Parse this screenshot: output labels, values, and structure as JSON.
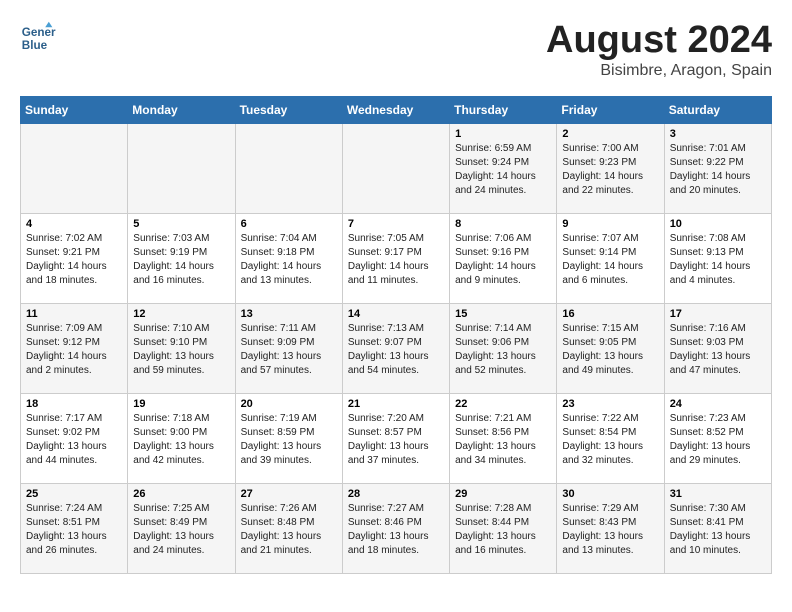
{
  "logo": {
    "line1": "General",
    "line2": "Blue"
  },
  "title": "August 2024",
  "location": "Bisimbre, Aragon, Spain",
  "weekdays": [
    "Sunday",
    "Monday",
    "Tuesday",
    "Wednesday",
    "Thursday",
    "Friday",
    "Saturday"
  ],
  "weeks": [
    [
      {
        "day": "",
        "info": ""
      },
      {
        "day": "",
        "info": ""
      },
      {
        "day": "",
        "info": ""
      },
      {
        "day": "",
        "info": ""
      },
      {
        "day": "1",
        "info": "Sunrise: 6:59 AM\nSunset: 9:24 PM\nDaylight: 14 hours\nand 24 minutes."
      },
      {
        "day": "2",
        "info": "Sunrise: 7:00 AM\nSunset: 9:23 PM\nDaylight: 14 hours\nand 22 minutes."
      },
      {
        "day": "3",
        "info": "Sunrise: 7:01 AM\nSunset: 9:22 PM\nDaylight: 14 hours\nand 20 minutes."
      }
    ],
    [
      {
        "day": "4",
        "info": "Sunrise: 7:02 AM\nSunset: 9:21 PM\nDaylight: 14 hours\nand 18 minutes."
      },
      {
        "day": "5",
        "info": "Sunrise: 7:03 AM\nSunset: 9:19 PM\nDaylight: 14 hours\nand 16 minutes."
      },
      {
        "day": "6",
        "info": "Sunrise: 7:04 AM\nSunset: 9:18 PM\nDaylight: 14 hours\nand 13 minutes."
      },
      {
        "day": "7",
        "info": "Sunrise: 7:05 AM\nSunset: 9:17 PM\nDaylight: 14 hours\nand 11 minutes."
      },
      {
        "day": "8",
        "info": "Sunrise: 7:06 AM\nSunset: 9:16 PM\nDaylight: 14 hours\nand 9 minutes."
      },
      {
        "day": "9",
        "info": "Sunrise: 7:07 AM\nSunset: 9:14 PM\nDaylight: 14 hours\nand 6 minutes."
      },
      {
        "day": "10",
        "info": "Sunrise: 7:08 AM\nSunset: 9:13 PM\nDaylight: 14 hours\nand 4 minutes."
      }
    ],
    [
      {
        "day": "11",
        "info": "Sunrise: 7:09 AM\nSunset: 9:12 PM\nDaylight: 14 hours\nand 2 minutes."
      },
      {
        "day": "12",
        "info": "Sunrise: 7:10 AM\nSunset: 9:10 PM\nDaylight: 13 hours\nand 59 minutes."
      },
      {
        "day": "13",
        "info": "Sunrise: 7:11 AM\nSunset: 9:09 PM\nDaylight: 13 hours\nand 57 minutes."
      },
      {
        "day": "14",
        "info": "Sunrise: 7:13 AM\nSunset: 9:07 PM\nDaylight: 13 hours\nand 54 minutes."
      },
      {
        "day": "15",
        "info": "Sunrise: 7:14 AM\nSunset: 9:06 PM\nDaylight: 13 hours\nand 52 minutes."
      },
      {
        "day": "16",
        "info": "Sunrise: 7:15 AM\nSunset: 9:05 PM\nDaylight: 13 hours\nand 49 minutes."
      },
      {
        "day": "17",
        "info": "Sunrise: 7:16 AM\nSunset: 9:03 PM\nDaylight: 13 hours\nand 47 minutes."
      }
    ],
    [
      {
        "day": "18",
        "info": "Sunrise: 7:17 AM\nSunset: 9:02 PM\nDaylight: 13 hours\nand 44 minutes."
      },
      {
        "day": "19",
        "info": "Sunrise: 7:18 AM\nSunset: 9:00 PM\nDaylight: 13 hours\nand 42 minutes."
      },
      {
        "day": "20",
        "info": "Sunrise: 7:19 AM\nSunset: 8:59 PM\nDaylight: 13 hours\nand 39 minutes."
      },
      {
        "day": "21",
        "info": "Sunrise: 7:20 AM\nSunset: 8:57 PM\nDaylight: 13 hours\nand 37 minutes."
      },
      {
        "day": "22",
        "info": "Sunrise: 7:21 AM\nSunset: 8:56 PM\nDaylight: 13 hours\nand 34 minutes."
      },
      {
        "day": "23",
        "info": "Sunrise: 7:22 AM\nSunset: 8:54 PM\nDaylight: 13 hours\nand 32 minutes."
      },
      {
        "day": "24",
        "info": "Sunrise: 7:23 AM\nSunset: 8:52 PM\nDaylight: 13 hours\nand 29 minutes."
      }
    ],
    [
      {
        "day": "25",
        "info": "Sunrise: 7:24 AM\nSunset: 8:51 PM\nDaylight: 13 hours\nand 26 minutes."
      },
      {
        "day": "26",
        "info": "Sunrise: 7:25 AM\nSunset: 8:49 PM\nDaylight: 13 hours\nand 24 minutes."
      },
      {
        "day": "27",
        "info": "Sunrise: 7:26 AM\nSunset: 8:48 PM\nDaylight: 13 hours\nand 21 minutes."
      },
      {
        "day": "28",
        "info": "Sunrise: 7:27 AM\nSunset: 8:46 PM\nDaylight: 13 hours\nand 18 minutes."
      },
      {
        "day": "29",
        "info": "Sunrise: 7:28 AM\nSunset: 8:44 PM\nDaylight: 13 hours\nand 16 minutes."
      },
      {
        "day": "30",
        "info": "Sunrise: 7:29 AM\nSunset: 8:43 PM\nDaylight: 13 hours\nand 13 minutes."
      },
      {
        "day": "31",
        "info": "Sunrise: 7:30 AM\nSunset: 8:41 PM\nDaylight: 13 hours\nand 10 minutes."
      }
    ]
  ]
}
